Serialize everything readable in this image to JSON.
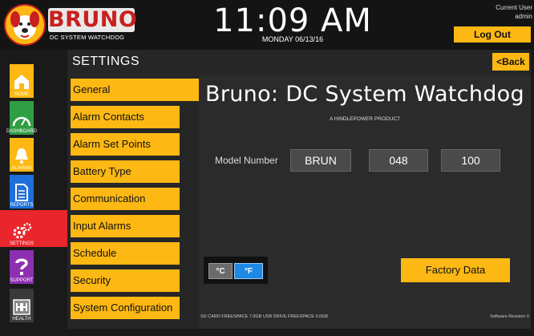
{
  "header": {
    "brand_name": "BRUNO",
    "brand_sub": "DC SYSTEM WATCHDOG",
    "time": "11:09 AM",
    "date": "MONDAY 06/13/16",
    "user_label": "Current User",
    "user_name": "admin",
    "logout_label": "Log Out"
  },
  "nav": {
    "items": [
      {
        "label": "HOME",
        "icon": "home-icon"
      },
      {
        "label": "DASHBOARD",
        "icon": "gauge-icon"
      },
      {
        "label": "ALARMS",
        "icon": "bell-icon"
      },
      {
        "label": "REPORTS",
        "icon": "document-icon"
      },
      {
        "label": "SETTINGS",
        "icon": "gears-icon",
        "active": true
      },
      {
        "label": "SUPPORT",
        "icon": "question-icon"
      },
      {
        "label": "HEALTH",
        "icon": "health-icon"
      }
    ]
  },
  "page": {
    "title": "SETTINGS",
    "back_label": "<Back"
  },
  "menu": {
    "items": [
      {
        "label": "General",
        "active": true
      },
      {
        "label": "Alarm Contacts"
      },
      {
        "label": "Alarm Set Points"
      },
      {
        "label": "Battery Type"
      },
      {
        "label": "Communication"
      },
      {
        "label": "Input Alarms"
      },
      {
        "label": "Schedule"
      },
      {
        "label": "Security"
      },
      {
        "label": "System Configuration"
      }
    ]
  },
  "general": {
    "title": "Bruno: DC System Watchdog",
    "subtitle": "A HINDLEPOWER PRODUCT",
    "model_label": "Model Number",
    "model_parts": [
      "BRUN",
      "048",
      "100"
    ],
    "unit_c": "°C",
    "unit_f": "°F",
    "unit_selected": "°F",
    "factory_label": "Factory Data",
    "footer_storage": "SD CARD FREESPACE   7.9GB   USB DRIVE FREESPACE   0.0GB",
    "footer_revision": "Software Revision 0"
  },
  "colors": {
    "accent": "#fdb813",
    "active_nav": "#e8262b",
    "toggle_selected": "#1e88e5",
    "brand_red": "#c8201e"
  }
}
